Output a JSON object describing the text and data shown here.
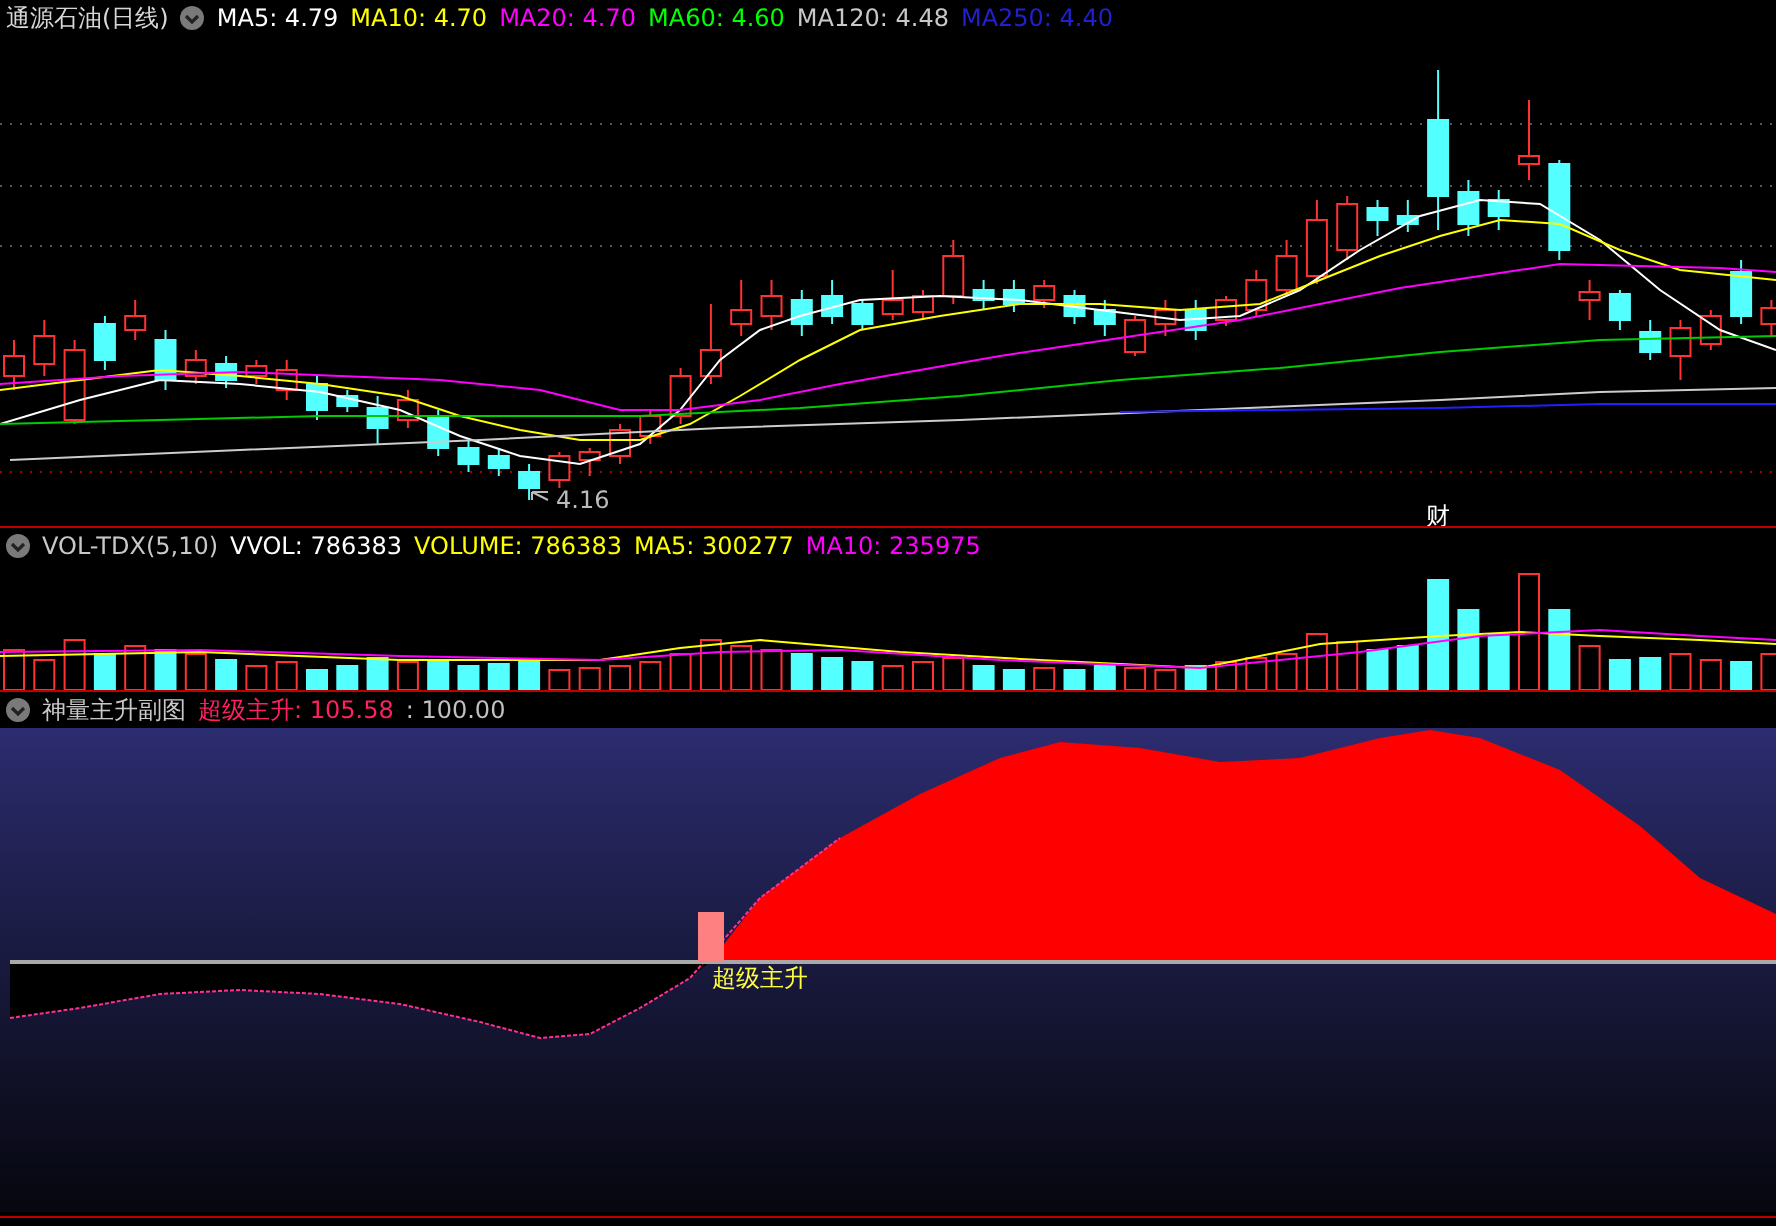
{
  "main_panel": {
    "title": "通源石油(日线)",
    "indicators": [
      {
        "label": "MA5: 4.79",
        "color": "#ffffff"
      },
      {
        "label": "MA10: 4.70",
        "color": "#ffff00"
      },
      {
        "label": "MA20: 4.70",
        "color": "#ff00ff"
      },
      {
        "label": "MA60: 4.60",
        "color": "#00ff00"
      },
      {
        "label": "MA120: 4.48",
        "color": "#c8c8c8"
      },
      {
        "label": "MA250: 4.40",
        "color": "#2020d0"
      }
    ],
    "annotations": [
      {
        "kind": "price",
        "text": "4.16"
      },
      {
        "kind": "marker",
        "text": "财"
      }
    ]
  },
  "volume_panel": {
    "title": "VOL-TDX(5,10)",
    "indicators": [
      {
        "label": "VVOL: 786383",
        "color": "#ffffff"
      },
      {
        "label": "VOLUME: 786383",
        "color": "#ffff00"
      },
      {
        "label": "MA5: 300277",
        "color": "#ffff00"
      },
      {
        "label": "MA10: 235975",
        "color": "#ff00ff"
      }
    ]
  },
  "signal_panel": {
    "title": "神量主升副图",
    "indicators": [
      {
        "label": "超级主升: 105.58",
        "color": "#ff2060"
      },
      {
        "label": ": 100.00",
        "color": "#c0c0c0"
      }
    ],
    "signal_label": "超级主升"
  }
}
